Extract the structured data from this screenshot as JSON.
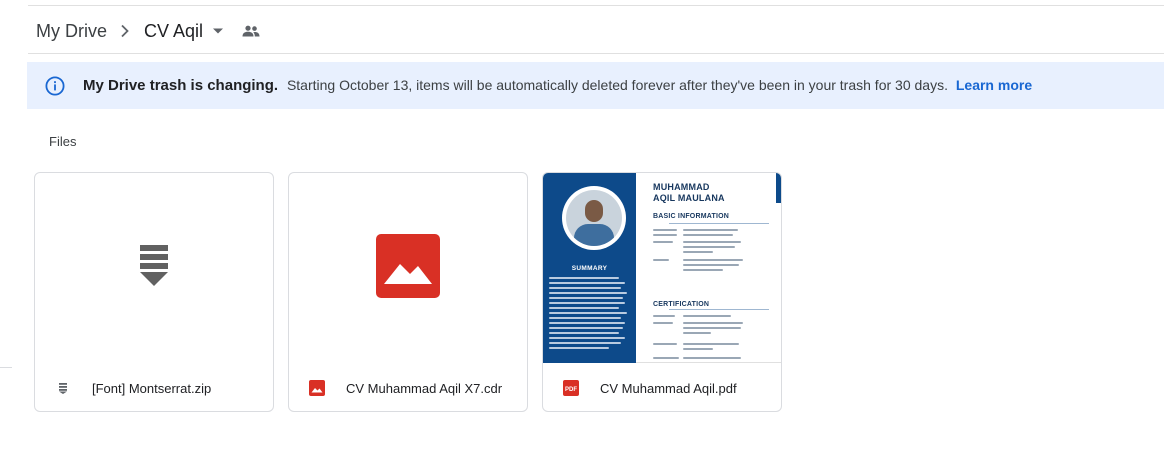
{
  "breadcrumb": {
    "root": "My Drive",
    "current": "CV Aqil"
  },
  "banner": {
    "bold": "My Drive trash is changing.",
    "text": "Starting October 13, items will be automatically deleted forever after they've been in your trash for 30 days.",
    "link": "Learn more"
  },
  "section_label": "Files",
  "files": [
    {
      "name": "[Font] Montserrat.zip",
      "icon": "archive-icon"
    },
    {
      "name": "CV Muhammad Aqil X7.cdr",
      "icon": "image-icon"
    },
    {
      "name": "CV Muhammad Aqil.pdf",
      "icon": "pdf-icon"
    }
  ],
  "pdf_preview": {
    "name_line1": "MUHAMMAD",
    "name_line2": "AQIL MAULANA",
    "section_basic": "BASIC INFORMATION",
    "section_cert": "CERTIFICATION",
    "summary_title": "SUMMARY"
  },
  "colors": {
    "banner_bg": "#e8f0fe",
    "link": "#1967d2",
    "image_red": "#d93025",
    "pdf_navy": "#0d4a8a"
  }
}
